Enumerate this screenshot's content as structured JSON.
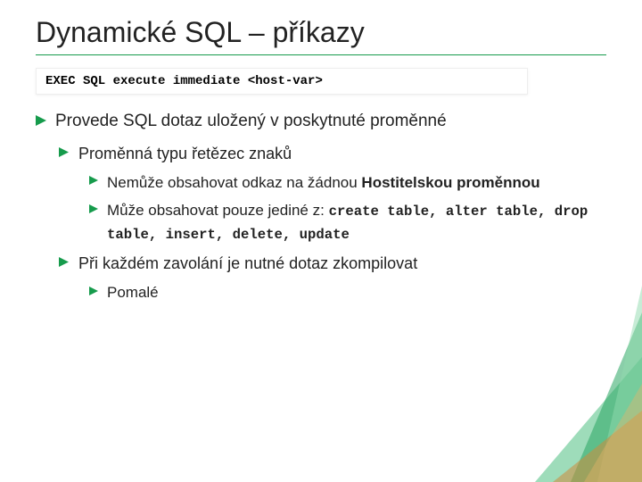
{
  "title": "Dynamické SQL – příkazy",
  "code": "EXEC SQL execute immediate <host-var>",
  "b1_text": "Provede SQL dotaz uložený v poskytnuté proměnné",
  "b2a_text": "Proměnná typu řetězec znaků",
  "b3a_prefix": "Nemůže obsahovat odkaz na žádnou ",
  "b3a_bold": "Hostitelskou proměnnou",
  "b3b_prefix": "Může obsahovat pouze jediné z: ",
  "b3b_code1": "create table, alter table, drop table, insert, delete, update",
  "b2b_text": "Při každém zavolání je nutné dotaz zkompilovat",
  "b4a_text": "Pomalé",
  "colors": {
    "accent": "#169b4c"
  }
}
